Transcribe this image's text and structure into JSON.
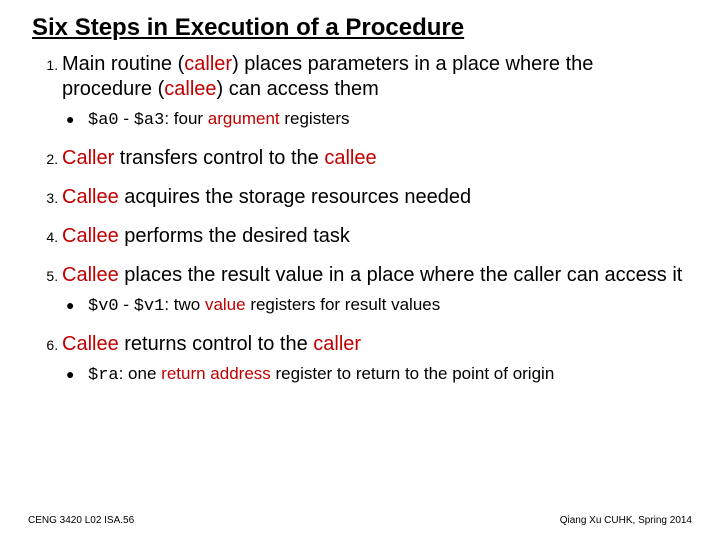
{
  "title": "Six Steps in Execution of a Procedure",
  "steps": {
    "s1": {
      "pre": "Main routine (",
      "caller": "caller",
      "mid": ") places parameters in a place where the procedure (",
      "callee": "callee",
      "post": ") can access them",
      "sub": {
        "code1": "$a0",
        "dash": " - ",
        "code2": "$a3",
        "colon": ": four ",
        "kw": "argument",
        "tail": " registers"
      }
    },
    "s2": {
      "caller": "Caller",
      "mid": " transfers control to the ",
      "callee": "callee"
    },
    "s3": {
      "callee": "Callee",
      "post": " acquires the storage resources needed"
    },
    "s4": {
      "callee": "Callee",
      "post": " performs the desired task"
    },
    "s5": {
      "callee": "Callee",
      "post": " places the result value in a place where the caller can access it",
      "sub": {
        "code1": "$v0",
        "dash": " - ",
        "code2": "$v1",
        "colon": ":  two ",
        "kw": "value",
        "tail": " registers for result values"
      }
    },
    "s6": {
      "callee": "Callee",
      "mid": " returns control to the ",
      "caller": "caller",
      "sub": {
        "code1": "$ra",
        "colon": ": one ",
        "kw": "return address",
        "tail": " register to return to the point of origin"
      }
    }
  },
  "footer": {
    "left": "CENG 3420 L02 ISA.56",
    "right": "Qiang Xu   CUHK, Spring 2014"
  }
}
